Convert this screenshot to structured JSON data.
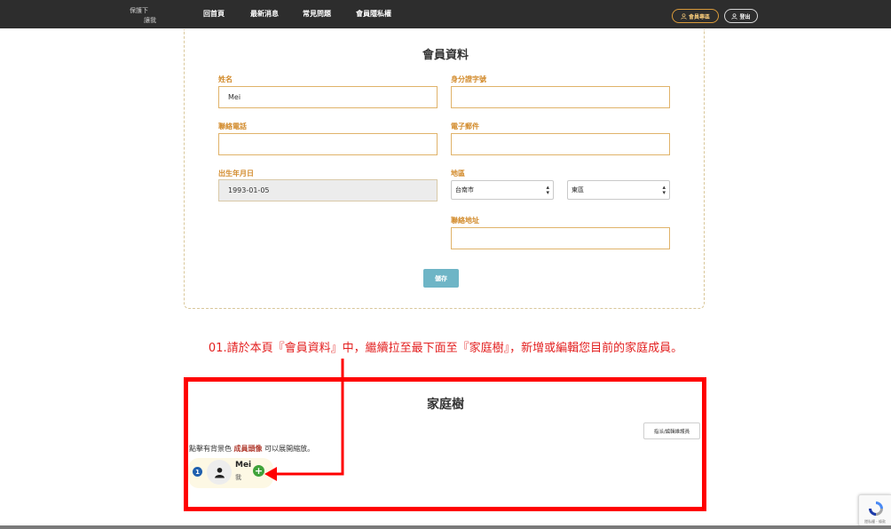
{
  "header": {
    "logo_line1": "保護下",
    "logo_line2": "讓我",
    "nav": [
      {
        "label": "回首頁"
      },
      {
        "label": "最新消息"
      },
      {
        "label": "常見問題"
      },
      {
        "label": "會員隱私權"
      }
    ],
    "member_area_label": "會員專區",
    "logout_label": "登出",
    "member_icon": "user-icon",
    "logout_icon": "user-icon",
    "background_color": "#2d2d2d",
    "accent_color": "#d99a3a"
  },
  "profile": {
    "title": "會員資料",
    "fields": {
      "name": {
        "label": "姓名",
        "value": "Mei"
      },
      "id_number": {
        "label": "身分證字號",
        "value": ""
      },
      "phone": {
        "label": "聯絡電話",
        "value": ""
      },
      "email": {
        "label": "電子郵件",
        "value": ""
      },
      "birthday": {
        "label": "出生年月日",
        "value": "1993-01-05"
      },
      "region": {
        "label": "地區",
        "city": "台南市",
        "district": "東區"
      },
      "address": {
        "label": "聯絡地址",
        "value": ""
      }
    },
    "save_label": "儲存",
    "label_color": "#d28a2a",
    "save_color": "#6eb5c6"
  },
  "instruction": "01.請於本頁『會員資料』中，繼續拉至最下面至『家庭樹』，新增或編輯您目前的家庭成員。",
  "family_tree": {
    "title": "家庭樹",
    "edit_button_label": "指派/編輯維護員",
    "hint_prefix": "點擊有背景色",
    "hint_highlight": "成員頭像",
    "hint_suffix": "可以展開縮放。",
    "member": {
      "badge": "1",
      "name": "Mei",
      "relation": "我",
      "avatar_icon": "person-icon",
      "add_icon": "plus-circle-icon"
    },
    "frame_color": "#ff0000"
  },
  "recaptcha": {
    "icon": "recaptcha-icon",
    "label": "隱私權 - 條款"
  }
}
